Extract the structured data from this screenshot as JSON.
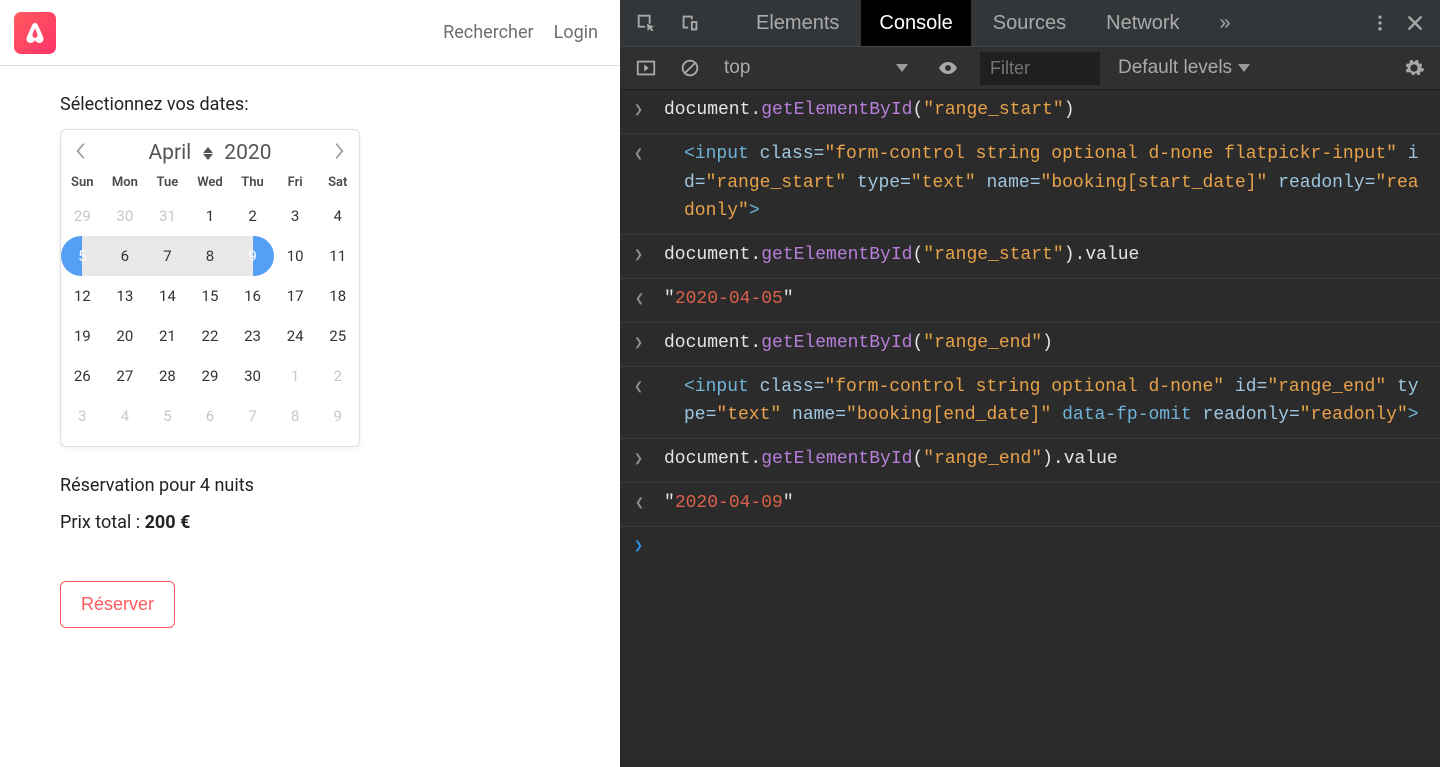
{
  "app": {
    "header": {
      "search_label": "Rechercher",
      "login_label": "Login"
    },
    "select_dates": "Sélectionnez vos dates:",
    "calendar": {
      "month": "April",
      "year": "2020",
      "dow": [
        "Sun",
        "Mon",
        "Tue",
        "Wed",
        "Thu",
        "Fri",
        "Sat"
      ],
      "rows": [
        [
          {
            "d": "29",
            "muted": true
          },
          {
            "d": "30",
            "muted": true
          },
          {
            "d": "31",
            "muted": true
          },
          {
            "d": "1"
          },
          {
            "d": "2"
          },
          {
            "d": "3"
          },
          {
            "d": "4"
          }
        ],
        [
          {
            "d": "5",
            "class": "sel-start"
          },
          {
            "d": "6",
            "class": "in-range"
          },
          {
            "d": "7",
            "class": "in-range"
          },
          {
            "d": "8",
            "class": "in-range"
          },
          {
            "d": "9",
            "class": "sel-end"
          },
          {
            "d": "10"
          },
          {
            "d": "11"
          }
        ],
        [
          {
            "d": "12"
          },
          {
            "d": "13"
          },
          {
            "d": "14"
          },
          {
            "d": "15"
          },
          {
            "d": "16"
          },
          {
            "d": "17"
          },
          {
            "d": "18"
          }
        ],
        [
          {
            "d": "19"
          },
          {
            "d": "20"
          },
          {
            "d": "21"
          },
          {
            "d": "22"
          },
          {
            "d": "23"
          },
          {
            "d": "24"
          },
          {
            "d": "25"
          }
        ],
        [
          {
            "d": "26"
          },
          {
            "d": "27"
          },
          {
            "d": "28"
          },
          {
            "d": "29"
          },
          {
            "d": "30"
          },
          {
            "d": "1",
            "muted": true
          },
          {
            "d": "2",
            "muted": true
          }
        ],
        [
          {
            "d": "3",
            "muted": true
          },
          {
            "d": "4",
            "muted": true
          },
          {
            "d": "5",
            "muted": true
          },
          {
            "d": "6",
            "muted": true
          },
          {
            "d": "7",
            "muted": true
          },
          {
            "d": "8",
            "muted": true
          },
          {
            "d": "9",
            "muted": true
          }
        ]
      ]
    },
    "reservation_line": "Réservation pour 4 nuits",
    "price_prefix": "Prix total : ",
    "price_value": "200 €",
    "reserve_label": "Réserver"
  },
  "devtools": {
    "tabs": [
      "Elements",
      "Console",
      "Sources",
      "Network"
    ],
    "active_tab": "Console",
    "more_glyph": "»",
    "toolbar": {
      "context": "top",
      "filter_placeholder": "Filter",
      "levels": "Default levels"
    },
    "log": {
      "e1_cmd_pre": "document.",
      "e1_cmd_method": "getElementById",
      "e1_cmd_arg": "\"range_start\"",
      "e1_resp_open_tag": "<input",
      "e1_resp_class_key": "class=",
      "e1_resp_class_val": "\"form-control string optional d-none flatpickr-input\"",
      "e1_resp_id_key": "id=",
      "e1_resp_id_val": "\"range_start\"",
      "e1_resp_type_key": "type=",
      "e1_resp_type_val": "\"text\"",
      "e1_resp_name_key": "name=",
      "e1_resp_name_val": "\"booking[start_date]\"",
      "e1_resp_ro_key": "readonly=",
      "e1_resp_ro_val": "\"readonly\"",
      "e1_resp_close": ">",
      "e2_cmd_pre": "document.",
      "e2_cmd_method": "getElementById",
      "e2_cmd_arg": "\"range_start\"",
      "e2_cmd_tail": ".value",
      "e2_resp_q1": "\"",
      "e2_resp_val": "2020-04-05",
      "e2_resp_q2": "\"",
      "e3_cmd_pre": "document.",
      "e3_cmd_method": "getElementById",
      "e3_cmd_arg": "\"range_end\"",
      "e3_resp_open_tag": "<input",
      "e3_resp_class_key": "class=",
      "e3_resp_class_val": "\"form-control string optional d-none\"",
      "e3_resp_id_key": "id=",
      "e3_resp_id_val": "\"range_end\"",
      "e3_resp_type_key": "type=",
      "e3_resp_type_val": "\"text\"",
      "e3_resp_name_key": "name=",
      "e3_resp_name_val": "\"booking[end_date]\"",
      "e3_resp_extra_attr": "data-fp-omit",
      "e3_resp_ro_key": "readonly=",
      "e3_resp_ro_val": "\"readonly\"",
      "e3_resp_close": ">",
      "e4_cmd_pre": "document.",
      "e4_cmd_method": "getElementById",
      "e4_cmd_arg": "\"range_end\"",
      "e4_cmd_tail": ".value",
      "e4_resp_q1": "\"",
      "e4_resp_val": "2020-04-09",
      "e4_resp_q2": "\""
    }
  }
}
